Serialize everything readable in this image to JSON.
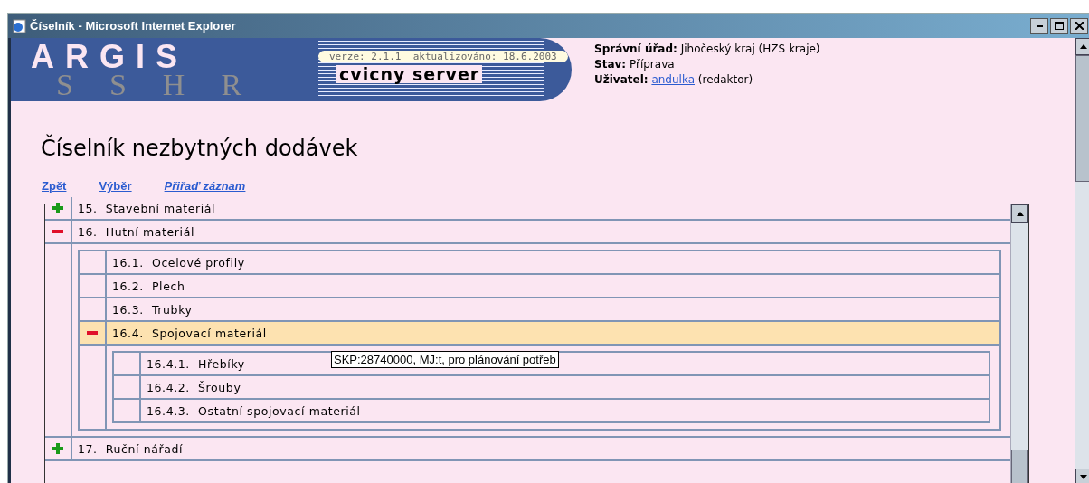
{
  "window": {
    "title": "Číselník - Microsoft Internet Explorer"
  },
  "banner": {
    "logo": "ARGIS",
    "logo_overlay": [
      "S",
      "S",
      "H",
      "R"
    ],
    "version": "verze: 2.1.1  aktualizováno: 18.6.2003",
    "server": "cvicny server"
  },
  "info": [
    {
      "label": "Správní úřad:",
      "value": "Jihočeský kraj (HZS kraje)"
    },
    {
      "label": "Stav:",
      "value": "Příprava"
    },
    {
      "label": "Uživatel:",
      "link": "andulka",
      "value": "(redaktor)"
    }
  ],
  "heading": "Číselník nezbytných dodávek",
  "links": [
    {
      "text": "Zpět",
      "italic": false
    },
    {
      "text": "Výběr",
      "italic": false
    },
    {
      "text": "Přiřaď záznam",
      "italic": true
    }
  ],
  "tree": [
    {
      "number": "15.",
      "label": "Stavební materiál",
      "expanded": false,
      "selected": false
    },
    {
      "number": "16.",
      "label": "Hutní materiál",
      "expanded": true,
      "selected": false,
      "children": [
        {
          "number": "16.1.",
          "label": "Ocelové profily",
          "selected": false
        },
        {
          "number": "16.2.",
          "label": "Plech",
          "selected": false
        },
        {
          "number": "16.3.",
          "label": "Trubky",
          "selected": false
        },
        {
          "number": "16.4.",
          "label": "Spojovací materiál",
          "expanded": true,
          "selected": true,
          "children": [
            {
              "number": "16.4.1.",
              "label": "Hřebíky",
              "selected": false,
              "tooltip": "SKP:28740000, MJ:t, pro plánování potřeb"
            },
            {
              "number": "16.4.2.",
              "label": "Šrouby",
              "selected": false
            },
            {
              "number": "16.4.3.",
              "label": "Ostatní spojovací materiál",
              "selected": false
            }
          ]
        }
      ]
    },
    {
      "number": "17.",
      "label": "Ruční nářadí",
      "expanded": false,
      "selected": false
    }
  ]
}
